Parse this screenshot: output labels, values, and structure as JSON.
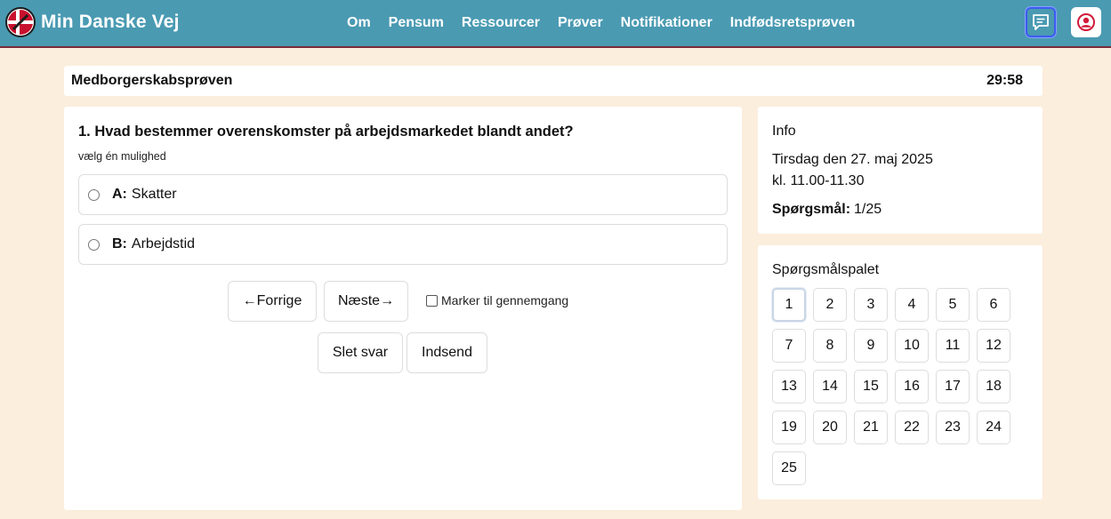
{
  "header": {
    "brand": "Min Danske Vej",
    "nav": [
      "Om",
      "Pensum",
      "Ressourcer",
      "Prøver",
      "Notifikationer",
      "Indfødsretsprøven"
    ]
  },
  "exam": {
    "title": "Medborgerskabsprøven",
    "timer": "29:58"
  },
  "question": {
    "title": "1. Hvad bestemmer overenskomster på arbejdsmarkedet blandt andet?",
    "hint": "vælg én mulighed",
    "options": [
      {
        "letter": "A:",
        "text": "Skatter"
      },
      {
        "letter": "B:",
        "text": "Arbejdstid"
      }
    ]
  },
  "controls": {
    "prev": "←Forrige",
    "next": "Næste→",
    "mark": "Marker til gennemgang",
    "clear": "Slet svar",
    "submit": "Indsend"
  },
  "info": {
    "heading": "Info",
    "date": "Tirsdag den 27. maj 2025",
    "time": "kl. 11.00-11.30",
    "count_label": "Spørgsmål:",
    "count_value": "1/25"
  },
  "palette": {
    "heading": "Spørgsmålspalet",
    "items": [
      "1",
      "2",
      "3",
      "4",
      "5",
      "6",
      "7",
      "8",
      "9",
      "10",
      "11",
      "12",
      "13",
      "14",
      "15",
      "16",
      "17",
      "18",
      "19",
      "20",
      "21",
      "22",
      "23",
      "24",
      "25"
    ],
    "active": "1"
  },
  "colors": {
    "header_bg": "#4a9ab2",
    "page_bg": "#fbeedd",
    "accent_border": "#3c5cf0"
  },
  "icons": {
    "logo": "danish-flag-logo-icon",
    "chat": "chat-icon",
    "user": "user-icon"
  }
}
